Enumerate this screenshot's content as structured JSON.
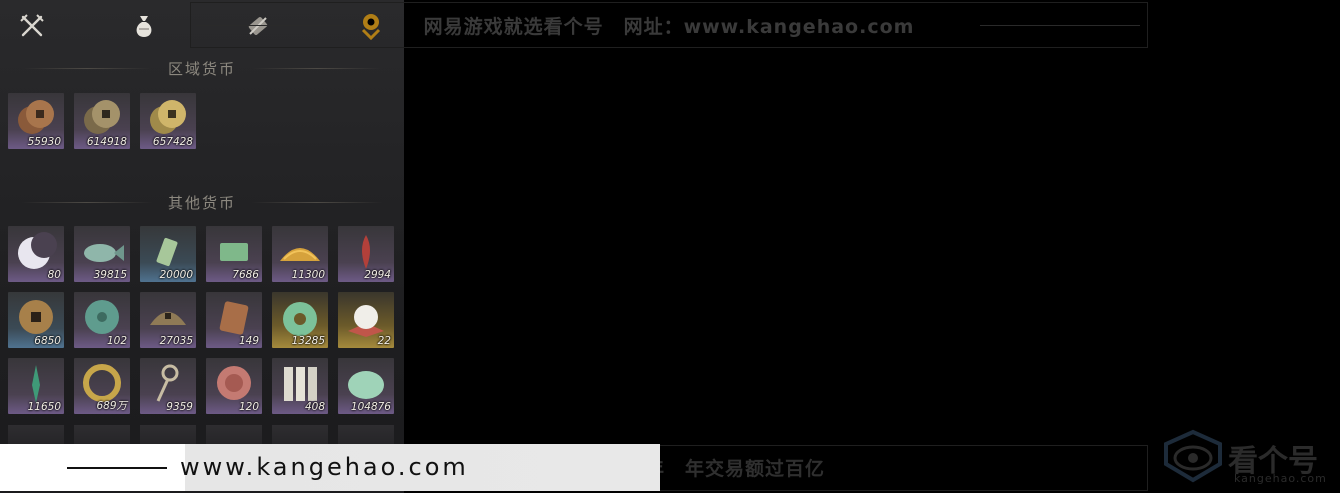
{
  "tabs": [
    {
      "name": "crossed-swords-icon"
    },
    {
      "name": "money-bag-icon"
    },
    {
      "name": "scroll-icon"
    }
  ],
  "sections": {
    "region_title": "区域货币",
    "other_title": "其他货币"
  },
  "region_items": [
    {
      "icon": "copper-coins-icon",
      "qty": "55930",
      "style": "purple"
    },
    {
      "icon": "bronze-coins-icon",
      "qty": "614918",
      "style": "purple"
    },
    {
      "icon": "gold-coins-icon",
      "qty": "657428",
      "style": "purple"
    }
  ],
  "other_items": [
    {
      "icon": "crescent-moon-icon",
      "qty": "80",
      "style": "purple"
    },
    {
      "icon": "jade-fish-icon",
      "qty": "39815",
      "style": "purple"
    },
    {
      "icon": "jade-tablet-icon",
      "qty": "20000",
      "style": "blue"
    },
    {
      "icon": "jade-slip-icon",
      "qty": "7686",
      "style": "purple"
    },
    {
      "icon": "gold-grain-icon",
      "qty": "11300",
      "style": "purple"
    },
    {
      "icon": "red-feather-icon",
      "qty": "2994",
      "style": "purple"
    },
    {
      "icon": "ancient-coin-icon",
      "qty": "6850",
      "style": "blue"
    },
    {
      "icon": "jade-disc-icon",
      "qty": "102",
      "style": "purple"
    },
    {
      "icon": "bronze-half-coin-icon",
      "qty": "27035",
      "style": "purple"
    },
    {
      "icon": "bronze-token-icon",
      "qty": "149",
      "style": "purple"
    },
    {
      "icon": "jade-ring-icon",
      "qty": "13285",
      "style": "gold"
    },
    {
      "icon": "pearl-icon",
      "qty": "22",
      "style": "gold"
    },
    {
      "icon": "jade-hairpin-icon",
      "qty": "11650",
      "style": "purple"
    },
    {
      "icon": "gold-bracelet-icon",
      "qty": "689万",
      "style": "purple"
    },
    {
      "icon": "key-coin-icon",
      "qty": "9359",
      "style": "purple"
    },
    {
      "icon": "red-coin-icon",
      "qty": "120",
      "style": "purple"
    },
    {
      "icon": "bamboo-slips-icon",
      "qty": "408",
      "style": "purple"
    },
    {
      "icon": "jade-stone-icon",
      "qty": "104876",
      "style": "purple"
    }
  ],
  "watermark": {
    "top_text": "网易游戏就选看个号　网址：www.kangehao.com",
    "bottom_text": "看个号专业网易游戏八年　年交易额过百亿",
    "url_text": "www.kangehao.com",
    "brand_name": "看个号",
    "brand_domain": "kangehao.com"
  },
  "colors": {
    "item_purple": "#6d5a86",
    "item_gold": "#a58a3c",
    "item_blue": "#4f7290",
    "qty_text": "#f1ede4",
    "title_text": "#8c887f"
  }
}
